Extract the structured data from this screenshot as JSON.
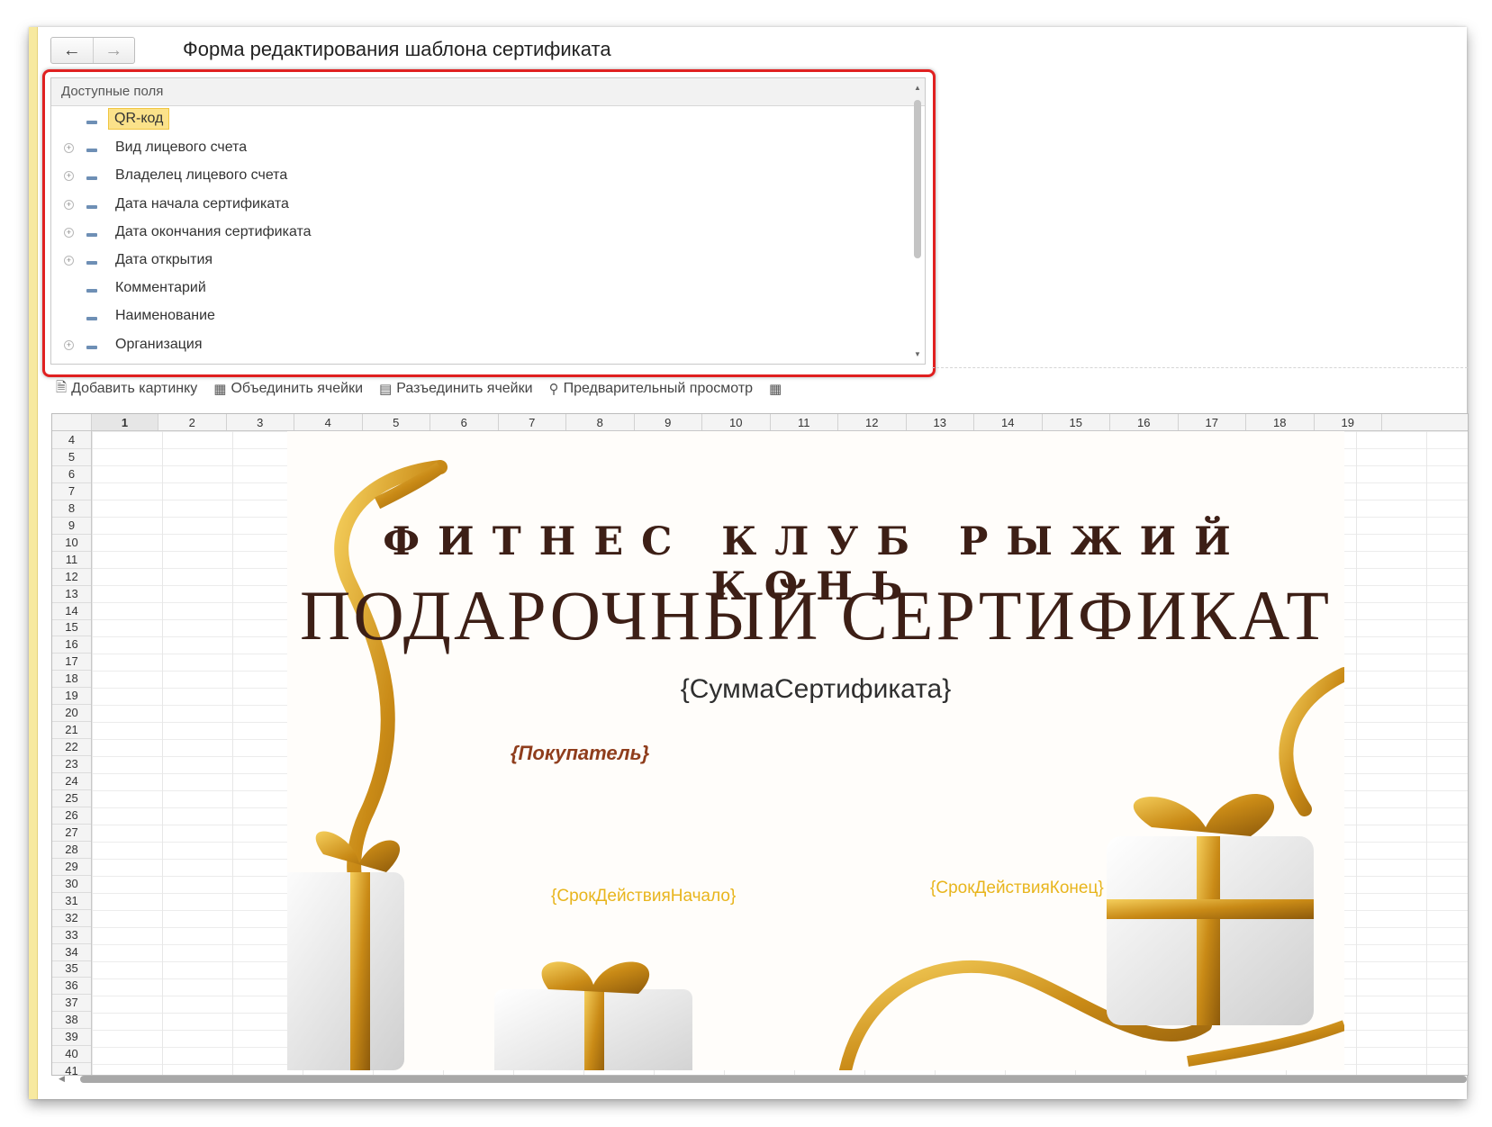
{
  "window": {
    "title": "Форма редактирования шаблона сертификата",
    "nav_back_icon": "arrow-left-icon",
    "nav_forward_icon": "arrow-right-icon"
  },
  "fields_panel": {
    "header": "Доступные поля",
    "items": [
      {
        "label": "QR-код",
        "expandable": false,
        "selected": true
      },
      {
        "label": "Вид лицевого счета",
        "expandable": true,
        "selected": false
      },
      {
        "label": "Владелец лицевого счета",
        "expandable": true,
        "selected": false
      },
      {
        "label": "Дата начала сертификата",
        "expandable": true,
        "selected": false
      },
      {
        "label": "Дата окончания сертификата",
        "expandable": true,
        "selected": false
      },
      {
        "label": "Дата открытия",
        "expandable": true,
        "selected": false
      },
      {
        "label": "Комментарий",
        "expandable": false,
        "selected": false
      },
      {
        "label": "Наименование",
        "expandable": false,
        "selected": false
      },
      {
        "label": "Организация",
        "expandable": true,
        "selected": false
      }
    ]
  },
  "toolbar": {
    "add_picture": "Добавить картинку",
    "merge_cells": "Объединить ячейки",
    "split_cells": "Разъединить ячейки",
    "preview": "Предварительный просмотр"
  },
  "sheet": {
    "columns": [
      "1",
      "2",
      "3",
      "4",
      "5",
      "6",
      "7",
      "8",
      "9",
      "10",
      "11",
      "12",
      "13",
      "14",
      "15",
      "16",
      "17",
      "18",
      "19"
    ],
    "active_column": "1",
    "rows": [
      "4",
      "5",
      "6",
      "7",
      "8",
      "9",
      "10",
      "11",
      "12",
      "13",
      "14",
      "15",
      "16",
      "17",
      "18",
      "19",
      "20",
      "21",
      "22",
      "23",
      "24",
      "25",
      "26",
      "27",
      "28",
      "29",
      "30",
      "31",
      "32",
      "33",
      "34",
      "35",
      "36",
      "37",
      "38",
      "39",
      "40",
      "41"
    ]
  },
  "certificate": {
    "club_name": "ФИТНЕС КЛУБ РЫЖИЙ КОНЬ",
    "title": "ПОДАРОЧНЫЙ СЕРТИФИКАТ",
    "sum_field": "{СуммаСертификата}",
    "buyer_field": "{Покупатель}",
    "start_field": "{СрокДействияНачало}",
    "end_field": "{СрокДействияКонец}",
    "ribbon_color": "#d39a1f",
    "title_color": "#3d1f16"
  }
}
